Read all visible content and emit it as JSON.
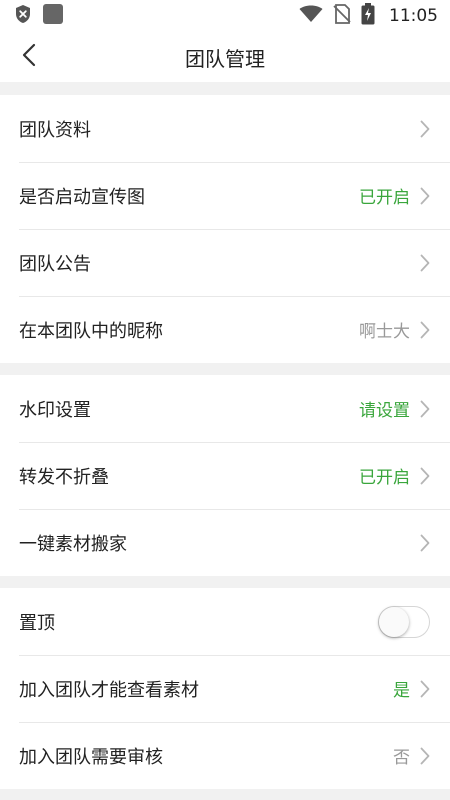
{
  "status_bar": {
    "time": "11:05",
    "icons": [
      "shield-x-icon",
      "notification-square-icon",
      "wifi-icon",
      "no-sim-icon",
      "battery-charging-icon"
    ]
  },
  "header": {
    "title": "团队管理",
    "back_icon": "chevron-left-icon"
  },
  "colors": {
    "accent_green": "#3aa63c",
    "value_gray": "#999999",
    "background": "#f1f1f1"
  },
  "groups": [
    {
      "rows": [
        {
          "label": "团队资料",
          "value": ""
        },
        {
          "label": "是否启动宣传图",
          "value": "已开启"
        },
        {
          "label": "团队公告",
          "value": ""
        },
        {
          "label": "在本团队中的昵称",
          "value": "啊士大"
        }
      ]
    },
    {
      "rows": [
        {
          "label": "水印设置",
          "value": "请设置"
        },
        {
          "label": "转发不折叠",
          "value": "已开启"
        },
        {
          "label": "一键素材搬家",
          "value": ""
        }
      ]
    },
    {
      "rows": [
        {
          "label": "置顶",
          "toggle": false
        },
        {
          "label": "加入团队才能查看素材",
          "value": "是"
        },
        {
          "label": "加入团队需要审核",
          "value": "否"
        }
      ]
    }
  ]
}
